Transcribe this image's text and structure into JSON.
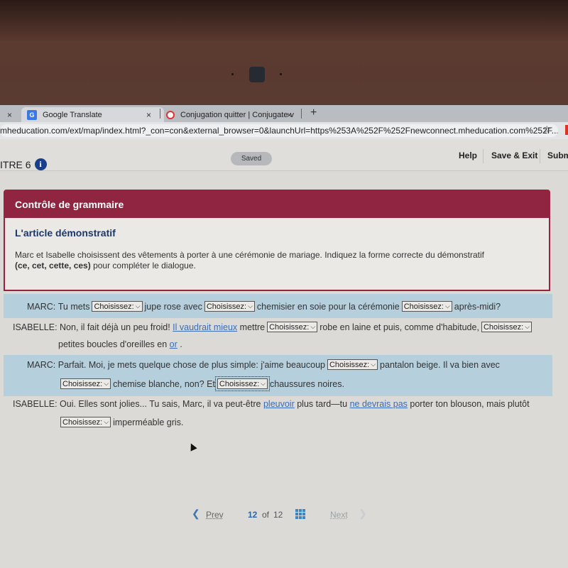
{
  "browser": {
    "tabs": [
      {
        "label": "",
        "close": "×"
      },
      {
        "label": "Google Translate",
        "icon": "google-translate-icon",
        "close": "×"
      },
      {
        "label": "Conjugation quitter | Conjugate v",
        "icon": "conjugation-site-icon",
        "close": "×"
      }
    ],
    "new_tab": "+",
    "url": "mheducation.com/ext/map/index.html?_con=con&external_browser=0&launchUrl=https%253A%252F%252Fnewconnect.mheducation.com%252F...",
    "bookmark_icon": "☆"
  },
  "appbar": {
    "chapter": "ITRE 6",
    "info_icon": "i",
    "status": "Saved",
    "help": "Help",
    "save_exit": "Save & Exit",
    "submit": "Subm"
  },
  "card": {
    "header": "Contrôle de grammaire",
    "subtitle": "L'article démonstratif",
    "desc_line1": "Marc et Isabelle choisissent des vêtements à porter à une cérémonie de mariage. Indiquez la forme correcte du démonstratif",
    "desc_bold": "(ce, cet, cette, ces)",
    "desc_line2_rest": " pour compléter le dialogue."
  },
  "select_placeholder": "Choisissez:",
  "dialogue": {
    "l1": {
      "speaker": "MARC:",
      "t1": "Tu mets",
      "t2": "jupe rose avec",
      "t3": "chemisier en soie pour la cérémonie",
      "t4": "après-midi?"
    },
    "l2": {
      "speaker": "ISABELLE:",
      "t1": "Non, il fait déjà un peu froid!",
      "link1": "Il vaudrait mieux",
      "t2": "mettre",
      "t3": "robe en laine et puis, comme d'habitude,",
      "t4": "petites boucles d'oreilles en",
      "link2": "or",
      "t5": "."
    },
    "l3": {
      "speaker": "MARC:",
      "t1": "Parfait. Moi, je mets quelque chose de plus simple: j'aime beaucoup",
      "t2": "pantalon beige. Il va bien avec",
      "t3": "chemise blanche, non? Et",
      "t4": "chaussures noires."
    },
    "l4": {
      "speaker": "ISABELLE:",
      "t1": "Oui. Elles sont jolies... Tu sais, Marc, il va peut-être",
      "link1": "pleuvoir",
      "t2": "plus tard—tu",
      "link2": "ne devrais pas",
      "t3": "porter ton blouson, mais plutôt",
      "t4": "imperméable gris."
    }
  },
  "pager": {
    "prev": "Prev",
    "current": "12",
    "of": "of",
    "total": "12",
    "next": "Next"
  }
}
